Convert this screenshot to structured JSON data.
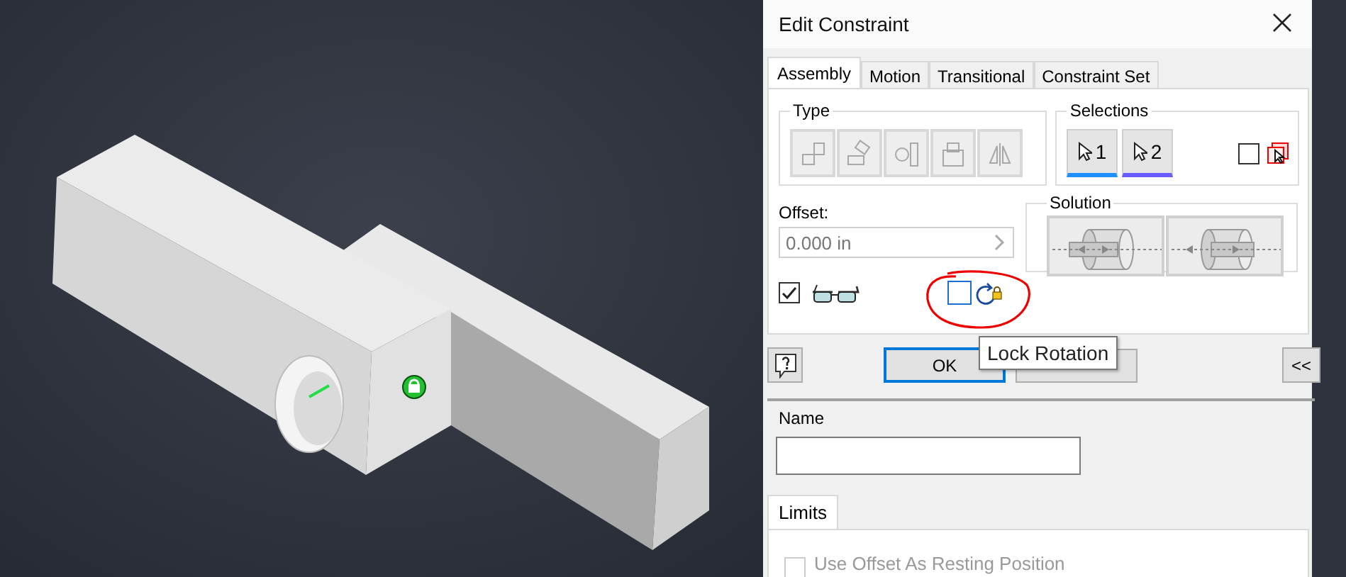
{
  "dialog": {
    "title": "Edit Constraint"
  },
  "tabs": [
    {
      "label": "Assembly",
      "selected": true
    },
    {
      "label": "Motion",
      "selected": false
    },
    {
      "label": "Transitional",
      "selected": false
    },
    {
      "label": "Constraint Set",
      "selected": false
    }
  ],
  "type_group": {
    "title": "Type",
    "disabled": true,
    "buttons": [
      {
        "kind": "mate"
      },
      {
        "kind": "angle"
      },
      {
        "kind": "tangent"
      },
      {
        "kind": "insert"
      },
      {
        "kind": "symmetry"
      }
    ]
  },
  "selections": {
    "title": "Selections",
    "items": [
      {
        "label": "1",
        "color": "#1e8fff",
        "selected": true
      },
      {
        "label": "2",
        "color": "#6a5cff",
        "selected": true
      }
    ],
    "first_occurrence_checked": false
  },
  "offset": {
    "label": "Offset:",
    "value": "0.000 in"
  },
  "show_preview": {
    "checked": true
  },
  "lock_rotation": {
    "checked": false,
    "tooltip": "Lock Rotation"
  },
  "solution": {
    "title": "Solution",
    "buttons": [
      {
        "kind": "opposed"
      },
      {
        "kind": "aligned"
      }
    ]
  },
  "buttons": {
    "ok": "OK",
    "expand": "<<"
  },
  "name": {
    "label": "Name"
  },
  "limits": {
    "tab": "Limits",
    "use_offset": {
      "label": "Use Offset As Resting Position",
      "checked": false
    }
  }
}
